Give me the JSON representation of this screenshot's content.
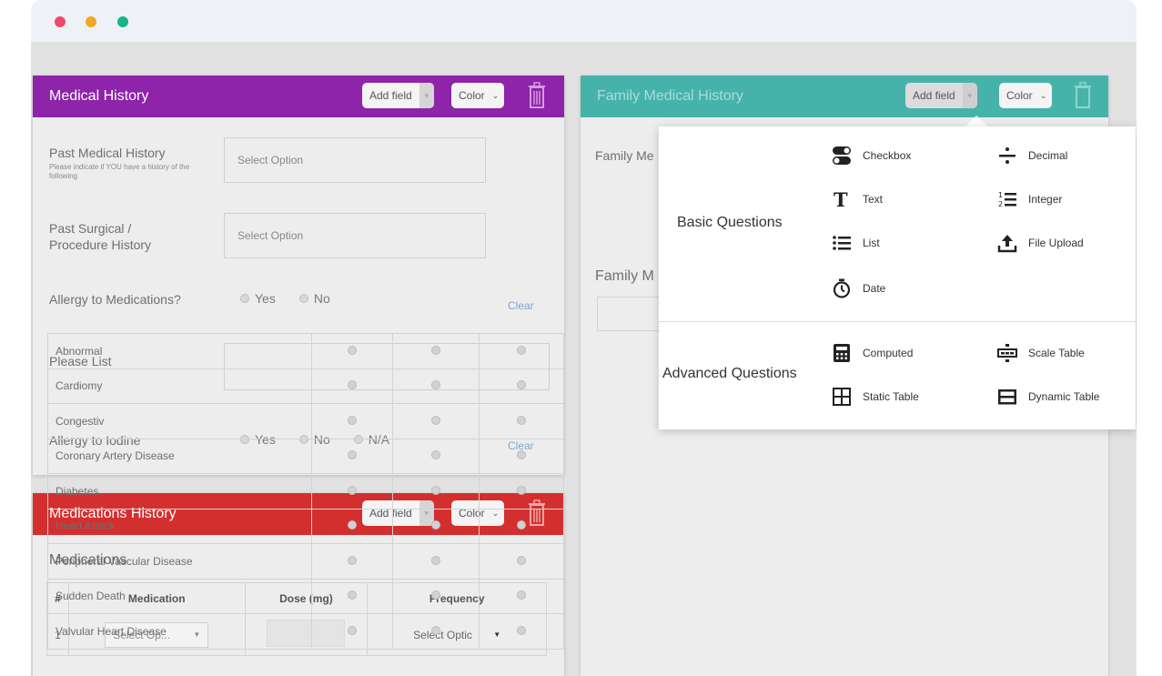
{
  "window": {
    "dots": [
      "close",
      "minimize",
      "maximize"
    ]
  },
  "colors": {
    "medical_history": "#8e24aa",
    "medications_history": "#d32f2f",
    "family_history": "#46b3aa"
  },
  "medical_history": {
    "title": "Medical History",
    "add_field": "Add field",
    "color": "Color",
    "past_medical_label": "Past Medical History",
    "past_medical_hint": "Please indicate if YOU have a history of the following",
    "past_medical_placeholder": "Select Option",
    "past_surgical_label": "Past Surgical / Procedure History",
    "past_surgical_placeholder": "Select Option",
    "allergy_meds_label": "Allergy to Medications?",
    "allergy_meds_options": [
      "Yes",
      "No"
    ],
    "clear_1": "Clear",
    "please_list_label": "Please List",
    "allergy_iodine_label": "Allergy to Iodine",
    "allergy_iodine_options": [
      "Yes",
      "No",
      "N/A"
    ],
    "clear_2": "Clear"
  },
  "medications_history": {
    "title": "Medications History",
    "add_field": "Add field",
    "color": "Color",
    "section_label": "Medications",
    "columns": [
      "#",
      "Medication",
      "Dose (mg)",
      "Frequency"
    ],
    "row_number": "1",
    "medication_select": "Select Op...",
    "frequency_select": "Select Optic"
  },
  "family_history": {
    "title": "Family Medical History",
    "add_field": "Add field",
    "color": "Color",
    "label_1": "Family Me",
    "label_2": "Family M",
    "conditions": [
      "Abnormal",
      "Cardiomy",
      "Congestiv",
      "Coronary Artery Disease",
      "Diabetes",
      "Heart Attack",
      "Peripheral Vascular Disease",
      "Sudden Death",
      "Valvular Heart Disease"
    ]
  },
  "popover": {
    "basic_title": "Basic Questions",
    "advanced_title": "Advanced Questions",
    "basic_items": [
      {
        "label": "Checkbox",
        "icon": "toggle-icon"
      },
      {
        "label": "Decimal",
        "icon": "divide-icon"
      },
      {
        "label": "Text",
        "icon": "text-icon"
      },
      {
        "label": "Integer",
        "icon": "numbered-list-icon"
      },
      {
        "label": "List",
        "icon": "list-icon"
      },
      {
        "label": "File Upload",
        "icon": "upload-icon"
      },
      {
        "label": "Date",
        "icon": "timer-icon"
      }
    ],
    "advanced_items": [
      {
        "label": "Computed",
        "icon": "calculator-icon"
      },
      {
        "label": "Scale Table",
        "icon": "scale-table-icon"
      },
      {
        "label": "Static Table",
        "icon": "grid-icon"
      },
      {
        "label": "Dynamic Table",
        "icon": "dynamic-table-icon"
      }
    ]
  }
}
